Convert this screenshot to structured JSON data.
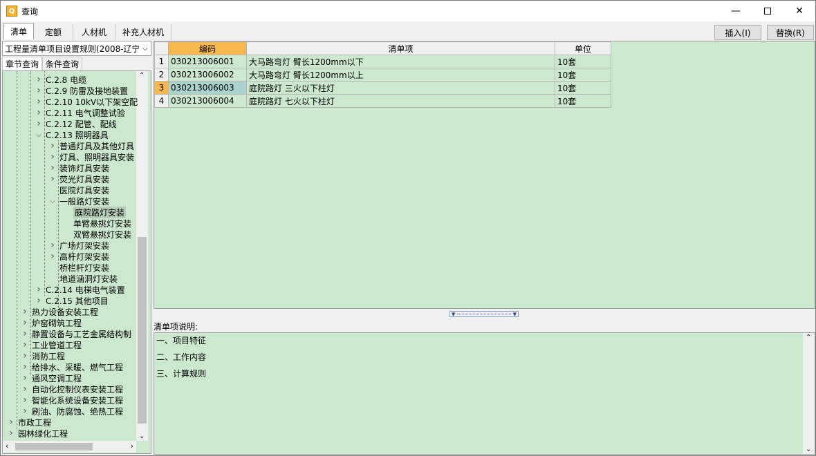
{
  "window": {
    "title": "查询",
    "app_icon": "Q"
  },
  "tabs": [
    {
      "label": "清单"
    },
    {
      "label": "定额"
    },
    {
      "label": "人材机"
    },
    {
      "label": "补充人材机"
    }
  ],
  "toolbar": {
    "insert_label": "插入(I)",
    "replace_label": "替换(R)"
  },
  "rule_select": {
    "value": "工程量清单项目设置规则(2008-辽宁"
  },
  "subtabs": [
    {
      "label": "章节查询"
    },
    {
      "label": "条件查询"
    }
  ],
  "tree": [
    {
      "label": "C.2.8 电缆"
    },
    {
      "label": "C.2.9 防雷及接地装置"
    },
    {
      "label": "C.2.10 10kV以下架空配"
    },
    {
      "label": "C.2.11 电气调整试验"
    },
    {
      "label": "C.2.12 配管、配线"
    },
    {
      "label": "C.2.13 照明器具"
    },
    {
      "label": "普通灯具及其他灯具"
    },
    {
      "label": "灯具、照明器具安装"
    },
    {
      "label": "装饰灯具安装"
    },
    {
      "label": "荧光灯具安装"
    },
    {
      "label": "医院灯具安装"
    },
    {
      "label": "一般路灯安装"
    },
    {
      "label": "庭院路灯安装"
    },
    {
      "label": "单臂悬挑灯安装"
    },
    {
      "label": "双臂悬挑灯安装"
    },
    {
      "label": "广场灯架安装"
    },
    {
      "label": "高杆灯架安装"
    },
    {
      "label": "桥栏杆灯安装"
    },
    {
      "label": "地道涵洞灯安装"
    },
    {
      "label": "C.2.14 电梯电气装置"
    },
    {
      "label": "C.2.15 其他项目"
    },
    {
      "label": "热力设备安装工程"
    },
    {
      "label": "炉窑砌筑工程"
    },
    {
      "label": "静置设备与工艺金属结构制"
    },
    {
      "label": "工业管道工程"
    },
    {
      "label": "消防工程"
    },
    {
      "label": "给排水、采暖、燃气工程"
    },
    {
      "label": "通风空调工程"
    },
    {
      "label": "自动化控制仪表安装工程"
    },
    {
      "label": "智能化系统设备安装工程"
    },
    {
      "label": "刷油、防腐蚀、绝热工程"
    },
    {
      "label": "市政工程"
    },
    {
      "label": "园林绿化工程"
    }
  ],
  "table": {
    "columns": [
      "编码",
      "清单项",
      "单位"
    ],
    "rows": [
      {
        "num": "1",
        "code": "030213006001",
        "item": "大马路弯灯 臂长1200mm以下",
        "unit": "10套"
      },
      {
        "num": "2",
        "code": "030213006002",
        "item": "大马路弯灯 臂长1200mm以上",
        "unit": "10套"
      },
      {
        "num": "3",
        "code": "030213006003",
        "item": "庭院路灯 三火以下柱灯",
        "unit": "10套"
      },
      {
        "num": "4",
        "code": "030213006004",
        "item": "庭院路灯 七火以下柱灯",
        "unit": "10套"
      }
    ]
  },
  "description": {
    "label": "清单项说明:",
    "lines": [
      "一、项目特征",
      "二、工作内容",
      "三、计算规则"
    ]
  }
}
